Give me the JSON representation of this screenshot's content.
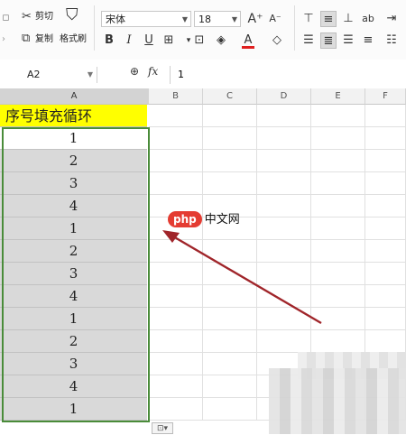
{
  "ribbon": {
    "cut_label": "剪切",
    "copy_label": "复制",
    "format_painter_label": "格式刷",
    "font_name": "宋体",
    "font_size": "18",
    "bold_label": "B",
    "italic_label": "I",
    "underline_label": "U",
    "font_color_label": "A",
    "grow_font_label": "A⁺",
    "shrink_font_label": "A⁻"
  },
  "formula_bar": {
    "name_box": "A2",
    "fx_label": "fx",
    "value": "1"
  },
  "columns": [
    "A",
    "B",
    "C",
    "D",
    "E",
    "F"
  ],
  "sheet": {
    "header_cell": "序号填充循环",
    "values": [
      "1",
      "2",
      "3",
      "4",
      "1",
      "2",
      "3",
      "4",
      "1",
      "2",
      "3",
      "4",
      "1"
    ]
  },
  "watermark": {
    "php": "php",
    "cn": "中文网"
  },
  "colors": {
    "header_fill": "#ffff00",
    "selection_border": "#4a8c3a",
    "arrow": "#a0252a",
    "font_color_bar": "#e02020"
  },
  "paste_options_icon": "paste-options-icon"
}
